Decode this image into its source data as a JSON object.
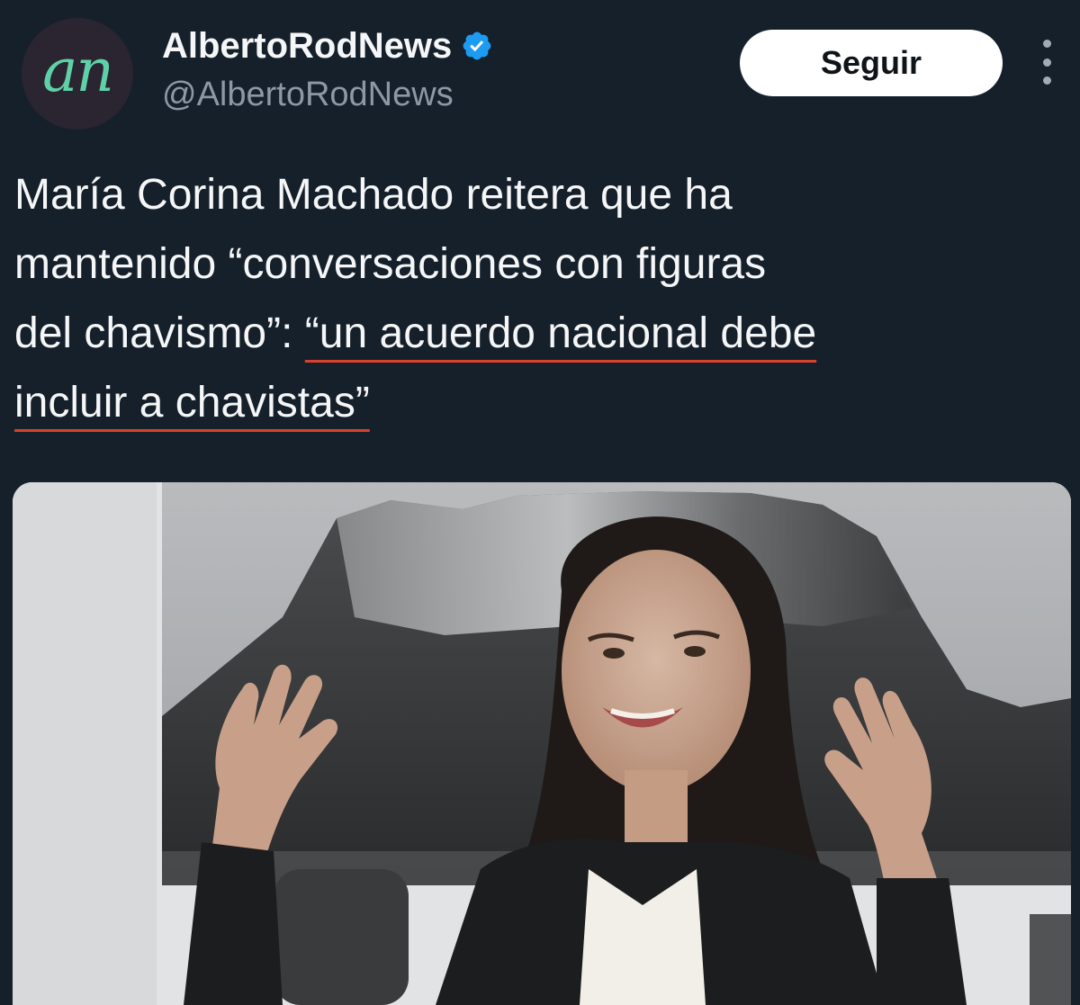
{
  "post": {
    "avatar_text": "an",
    "display_name": "AlbertoRodNews",
    "handle": "@AlbertoRodNews",
    "follow_label": "Seguir",
    "headline_lines": [
      "María Corina Machado reitera que ha",
      "mantenido “conversaciones con figuras",
      "del chavismo”: ",
      "“un acuerdo nacional debe",
      "incluir a chavistas”"
    ]
  },
  "colors": {
    "background": "#16202b",
    "verified_badge": "#1d9bf0",
    "underline": "#d9412b",
    "avatar_text": "#5fd1a8"
  },
  "icons": {
    "verified": "verified-badge-icon",
    "more": "more-options-icon"
  }
}
